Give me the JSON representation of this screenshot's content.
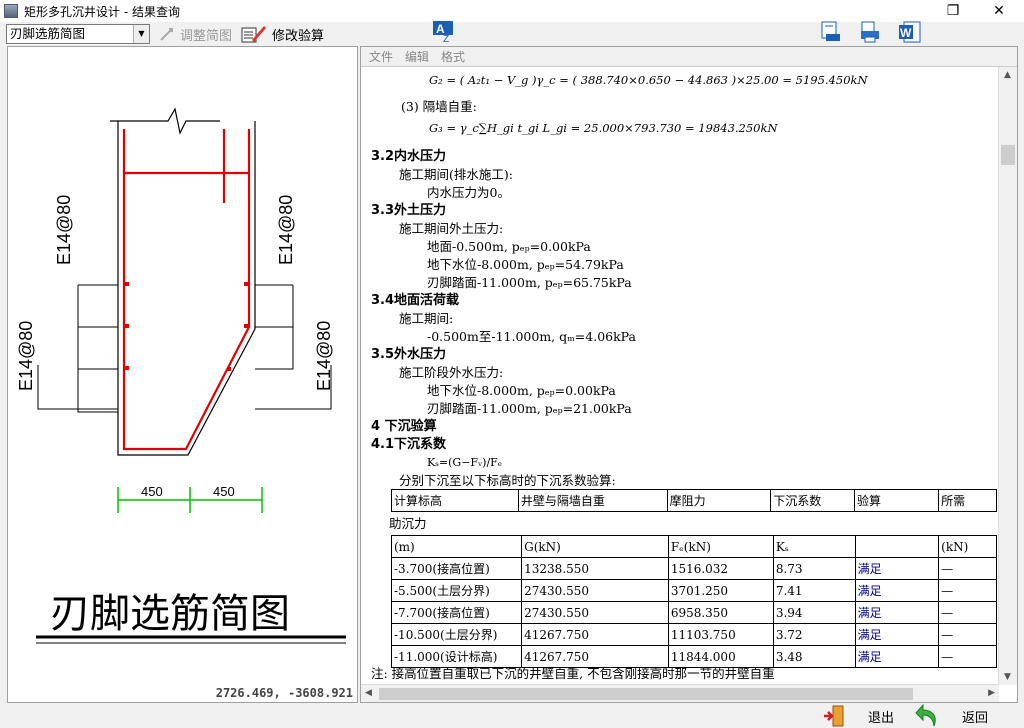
{
  "window": {
    "title": "矩形多孔沉井设计 - 结果查询",
    "restore_icon": "restore-icon",
    "close_icon": "close-icon"
  },
  "toolbar": {
    "view_select": "刃脚选筋简图",
    "adjust_label": "调整简图",
    "modify_label": "修改验算"
  },
  "drawing": {
    "title": "刃脚选筋简图",
    "rebar_label_1": "E14@80",
    "rebar_label_2": "E14@80",
    "rebar_label_3": "E14@80",
    "rebar_label_4": "E14@80",
    "dim_1": "450",
    "dim_2": "450",
    "coords": "2726.469, -3608.921"
  },
  "menu": {
    "file": "文件",
    "edit": "编辑",
    "format": "格式"
  },
  "report": {
    "g2_formula": "G₂ = ( A₂t₁ − V_g )γ_c = ( 388.740×0.650 − 44.863 )×25.00 = 5195.450kN",
    "partition_label": "(3)  隔墙自重:",
    "g3_formula": "G₃ = γ_c∑H_gi t_gi L_gi = 25.000×793.730 = 19843.250kN",
    "s32": "3.2内水压力",
    "s32_a": "施工期间(排水施工):",
    "s32_b": "内水压力为0。",
    "s33": "3.3外土压力",
    "s33_a": "施工期间外土压力:",
    "s33_b": "地面-0.500m, pₑₚ=0.00kPa",
    "s33_c": "地下水位-8.000m, pₑₚ=54.79kPa",
    "s33_d": "刃脚踏面-11.000m, pₑₚ=65.75kPa",
    "s34": "3.4地面活荷载",
    "s34_a": "施工期间:",
    "s34_b": "-0.500m至-11.000m, qₘ=4.06kPa",
    "s35": "3.5外水压力",
    "s35_a": "施工阶段外水压力:",
    "s35_b": "地下水位-8.000m, pₑₚ=0.00kPa",
    "s35_c": "刃脚踏面-11.000m, pₑₚ=21.00kPa",
    "s4": "4 下沉验算",
    "s41": "4.1下沉系数",
    "s41_formula": "Kₛ=(G−Fᵥ)/Fₑ",
    "s41_desc": "分别下沉至以下标高时的下沉系数验算:",
    "table_header": [
      "计算标高",
      "井壁与隔墙自重",
      "摩阻力",
      "下沉系数",
      "验算",
      "所需"
    ],
    "table_sub": "助沉力",
    "table_units": [
      "(m)",
      "G(kN)",
      "Fₑ(kN)",
      "Kₛ",
      "",
      "(kN)"
    ],
    "rows": [
      [
        "-3.700(接高位置)",
        "13238.550",
        "1516.032",
        "8.73",
        "满足",
        "—"
      ],
      [
        "-5.500(土层分界)",
        "27430.550",
        "3701.250",
        "7.41",
        "满足",
        "—"
      ],
      [
        "-7.700(接高位置)",
        "27430.550",
        "6958.350",
        "3.94",
        "满足",
        "—"
      ],
      [
        "-10.500(土层分界)",
        "41267.750",
        "11103.750",
        "3.72",
        "满足",
        "—"
      ],
      [
        "-11.000(设计标高)",
        "41267.750",
        "11844.000",
        "3.48",
        "满足",
        "—"
      ]
    ],
    "note": "注: 接高位置自重取已下沉的井壁自重, 不包含刚接高时那一节的井壁自重"
  },
  "bottom": {
    "exit_label": "退出",
    "back_label": "返回"
  },
  "colors": {
    "rebar": "#e00000",
    "dimension": "#00c000",
    "ok_text": "#00008b"
  }
}
